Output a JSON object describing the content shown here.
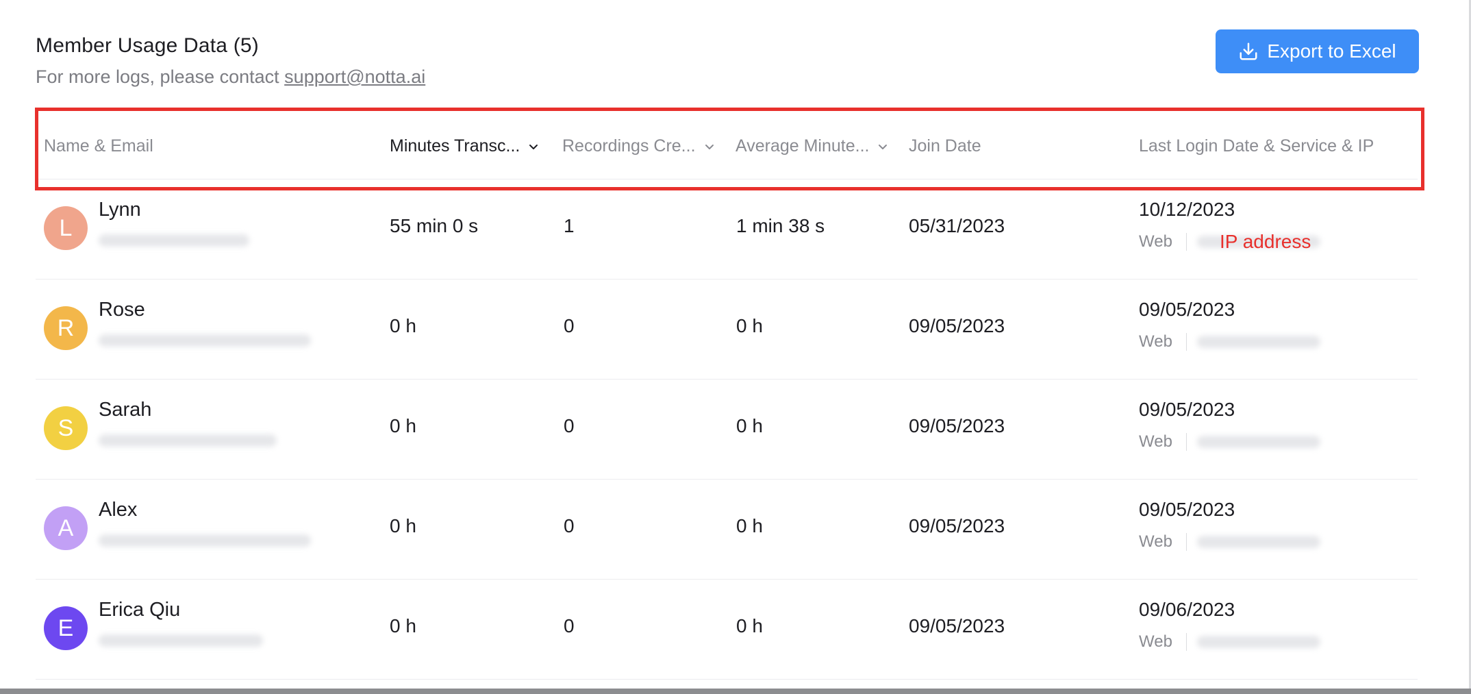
{
  "header": {
    "title": "Member Usage Data (5)",
    "subtitle_prefix": "For more logs, please contact ",
    "support_email": "support@notta.ai",
    "export_label": "Export to Excel"
  },
  "table": {
    "columns": [
      "Name & Email",
      "Minutes Transc...",
      "Recordings Cre...",
      "Average Minute...",
      "Join Date",
      "Last Login Date & Service & IP"
    ],
    "rows": [
      {
        "initial": "L",
        "avatar_color": "#f0a58c",
        "name": "Lynn",
        "minutes": "55 min 0 s",
        "recordings": "1",
        "average": "1 min 38 s",
        "join_date": "05/31/2023",
        "last_login": "10/12/2023",
        "service": "Web",
        "ip_label": "IP address"
      },
      {
        "initial": "R",
        "avatar_color": "#f3b74a",
        "name": "Rose",
        "minutes": "0 h",
        "recordings": "0",
        "average": "0 h",
        "join_date": "09/05/2023",
        "last_login": "09/05/2023",
        "service": "Web",
        "ip_label": ""
      },
      {
        "initial": "S",
        "avatar_color": "#f2d042",
        "name": "Sarah",
        "minutes": "0 h",
        "recordings": "0",
        "average": "0 h",
        "join_date": "09/05/2023",
        "last_login": "09/05/2023",
        "service": "Web",
        "ip_label": ""
      },
      {
        "initial": "A",
        "avatar_color": "#c2a0f5",
        "name": "Alex",
        "minutes": "0 h",
        "recordings": "0",
        "average": "0 h",
        "join_date": "09/05/2023",
        "last_login": "09/05/2023",
        "service": "Web",
        "ip_label": ""
      },
      {
        "initial": "E",
        "avatar_color": "#6d48f0",
        "name": "Erica Qiu",
        "minutes": "0 h",
        "recordings": "0",
        "average": "0 h",
        "join_date": "09/05/2023",
        "last_login": "09/06/2023",
        "service": "Web",
        "ip_label": ""
      }
    ]
  },
  "colors": {
    "accent": "#3e8ef7",
    "highlight": "#e8302c"
  }
}
